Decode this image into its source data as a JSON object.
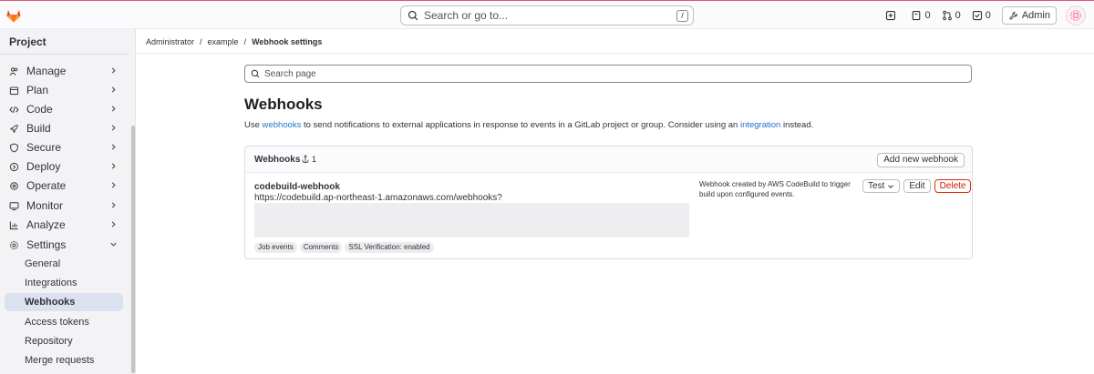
{
  "topbar": {
    "search_placeholder": "Search or go to...",
    "search_shortcut": "/",
    "issues_count": "0",
    "merge_requests_count": "0",
    "todos_count": "0",
    "admin_label": "Admin"
  },
  "sidebar": {
    "title": "Project",
    "items": [
      {
        "label": "Manage"
      },
      {
        "label": "Plan"
      },
      {
        "label": "Code"
      },
      {
        "label": "Build"
      },
      {
        "label": "Secure"
      },
      {
        "label": "Deploy"
      },
      {
        "label": "Operate"
      },
      {
        "label": "Monitor"
      },
      {
        "label": "Analyze"
      },
      {
        "label": "Settings"
      }
    ],
    "subitems": [
      {
        "label": "General"
      },
      {
        "label": "Integrations"
      },
      {
        "label": "Webhooks"
      },
      {
        "label": "Access tokens"
      },
      {
        "label": "Repository"
      },
      {
        "label": "Merge requests"
      }
    ]
  },
  "breadcrumb": {
    "items": [
      "Administrator",
      "example",
      "Webhook settings"
    ],
    "separator": "/"
  },
  "main": {
    "search_placeholder": "Search page",
    "title": "Webhooks",
    "desc_prefix": "Use ",
    "desc_link1": "webhooks",
    "desc_middle": " to send notifications to external applications in response to events in a GitLab project or group. Consider using an ",
    "desc_link2": "integration",
    "desc_suffix": " instead."
  },
  "card": {
    "title": "Webhooks",
    "count": "1",
    "add_button": "Add new webhook",
    "hook": {
      "name": "codebuild-webhook",
      "url": "https://codebuild.ap-northeast-1.amazonaws.com/webhooks?",
      "description": "Webhook created by AWS CodeBuild to trigger build upon configured events.",
      "badges": [
        "Job events",
        "Comments",
        "SSL Verification: enabled"
      ],
      "test_label": "Test",
      "edit_label": "Edit",
      "delete_label": "Delete"
    }
  },
  "colors": {
    "accent": "#1f75cb",
    "danger": "#dd2b0e",
    "active_nav": "#dbe1ef"
  }
}
